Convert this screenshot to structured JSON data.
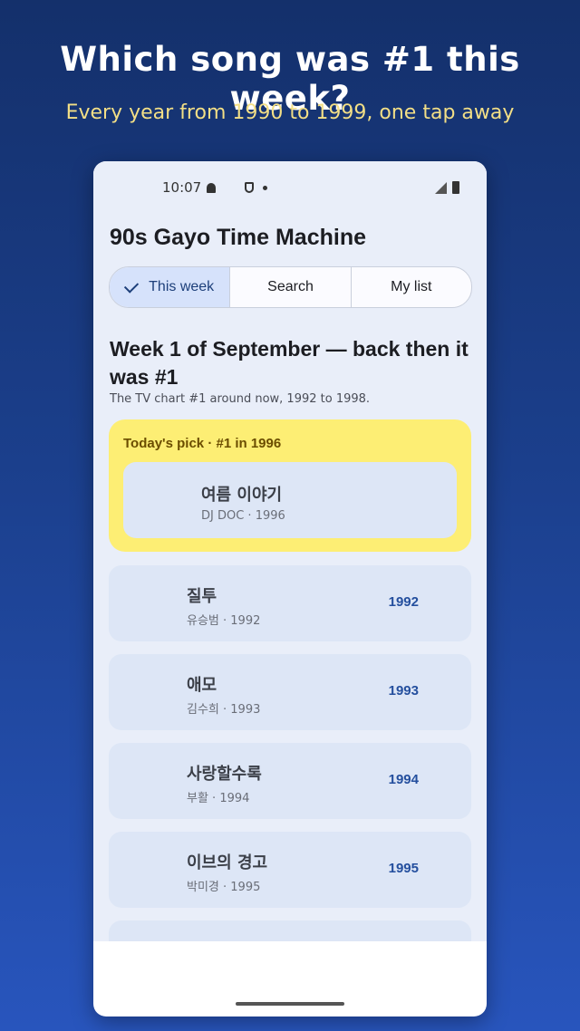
{
  "promo": {
    "headline": "Which song was #1 this week?",
    "subline": "Every year from 1990 to 1999, one tap away"
  },
  "status_bar": {
    "time": "10:07",
    "icons": [
      "bell-icon",
      "grid-icon",
      "shield-icon",
      "dot-icon",
      "signal-icon",
      "battery-icon"
    ]
  },
  "app": {
    "title": "90s Gayo Time Machine",
    "tabs": [
      {
        "label": "This week",
        "active": true
      },
      {
        "label": "Search",
        "active": false
      },
      {
        "label": "My list",
        "active": false
      }
    ],
    "section_title": "Week 1 of September — back then it was #1",
    "section_subtitle": "The TV chart #1 around now, 1992 to 1998.",
    "todays_pick": {
      "label": "Today's pick · #1 in 1996",
      "title": "여름 이야기",
      "meta": "DJ DOC · 1996"
    },
    "songs": [
      {
        "title": "질투",
        "meta": "유승범 · 1992",
        "year": "1992"
      },
      {
        "title": "애모",
        "meta": "김수희 · 1993",
        "year": "1993"
      },
      {
        "title": "사랑할수록",
        "meta": "부활 · 1994",
        "year": "1994"
      },
      {
        "title": "이브의 경고",
        "meta": "박미경 · 1995",
        "year": "1995"
      }
    ]
  },
  "colors": {
    "highlight": "#fdee74",
    "accent": "#244f9e",
    "card": "#dde6f6"
  }
}
